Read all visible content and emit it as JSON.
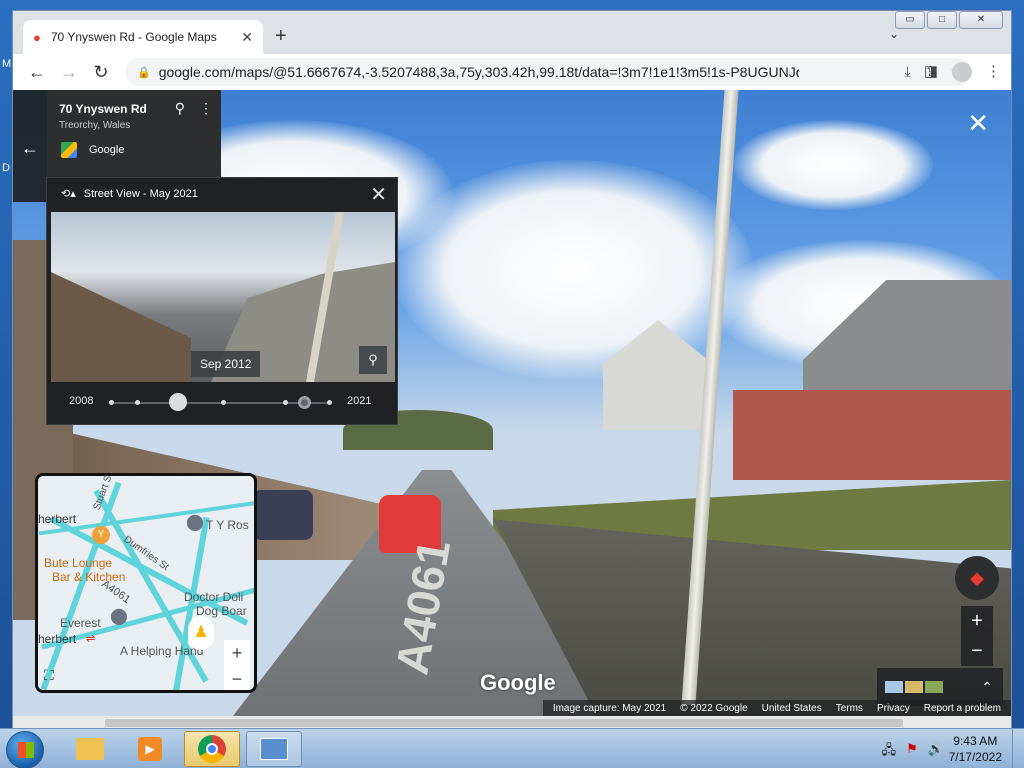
{
  "desktop": {
    "letter_m": "M",
    "letter_d": "D"
  },
  "browser": {
    "tab_title": "70 Ynyswen Rd - Google Maps",
    "tab_close": "✕",
    "new_tab": "+",
    "tabs_dropdown": "⌄",
    "window_controls": {
      "minimize": "▭",
      "maximize": "□",
      "close": "✕"
    },
    "url": "google.com/maps/@51.6667674,-3.5207488,3a,75y,303.42h,99.18t/data=!3m7!1e1!3m5!1s-P8UGUNJd...",
    "back": "←",
    "forward": "→",
    "reload": "↻"
  },
  "address_card": {
    "title": "70 Ynyswen Rd",
    "subtitle": "Treorchy, Wales",
    "source": "Google",
    "back": "←",
    "pin": "⚲",
    "menu": "⋮"
  },
  "time_machine": {
    "header": "Street View - May 2021",
    "close": "✕",
    "tooltip": "Sep 2012",
    "zoom": "⚲",
    "start_year": "2008",
    "end_year": "2021"
  },
  "minimap": {
    "labels": {
      "stuart": "Stuart St",
      "t_y_ros": "T Y Ros",
      "herbert": "herbert",
      "bute_lounge": "Bute Lounge",
      "bar_kitchen": "Bar & Kitchen",
      "dumfries": "Dumfries St",
      "a4061": "A4061",
      "doctor": "Doctor Doli",
      "dog_board": "Dog Boar",
      "everest": "Everest",
      "herbert2": "herbert",
      "helping_hand": "A Helping Hand"
    },
    "zoom_in": "+",
    "zoom_out": "−",
    "fullscreen": "⛶"
  },
  "viewport": {
    "close": "✕",
    "zoom_in": "+",
    "zoom_out": "−",
    "compass": "◆",
    "expand": "⌃",
    "road_text": "A4061",
    "watermark": "Google"
  },
  "attribution": {
    "capture": "Image capture: May 2021",
    "copyright": "© 2022 Google",
    "region": "United States",
    "terms": "Terms",
    "privacy": "Privacy",
    "report": "Report a problem"
  },
  "taskbar": {
    "time": "9:43 AM",
    "date": "7/17/2022"
  }
}
